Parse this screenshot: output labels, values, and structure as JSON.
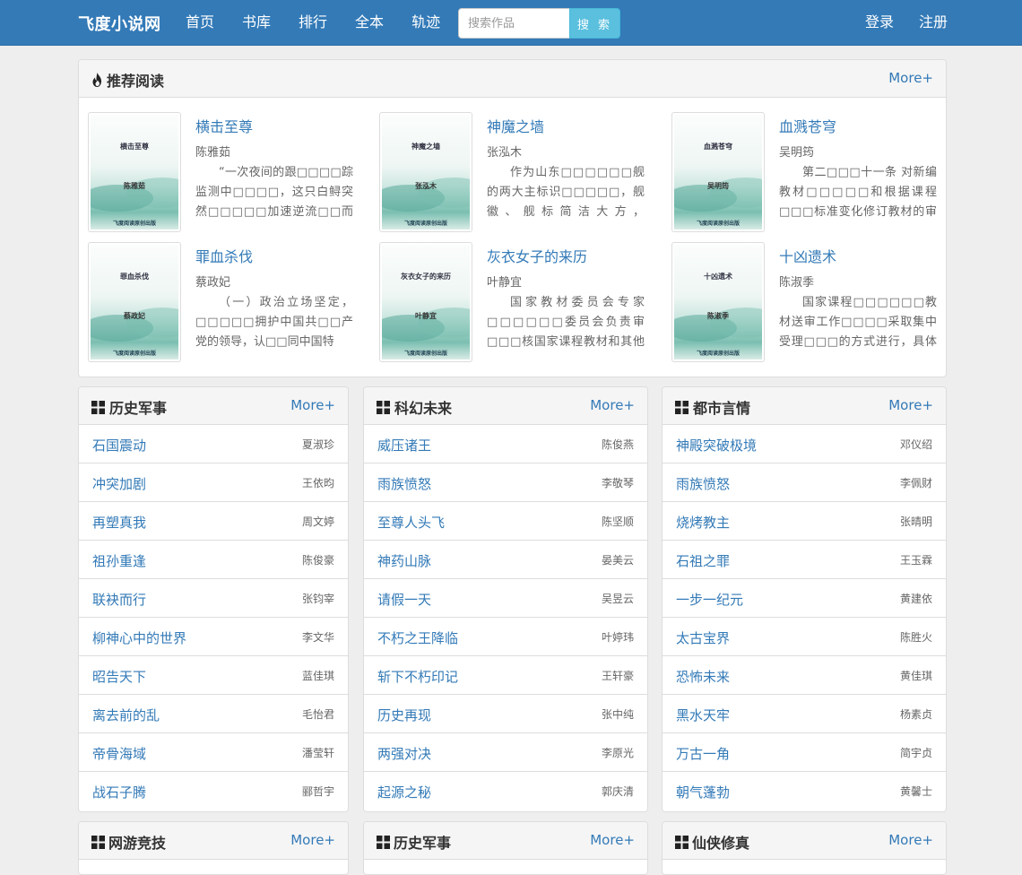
{
  "nav": {
    "brand": "飞度小说网",
    "links": [
      "首页",
      "书库",
      "排行",
      "全本",
      "轨迹"
    ],
    "search_placeholder": "搜索作品",
    "search_button": "搜 索",
    "login": "登录",
    "register": "注册"
  },
  "recommend": {
    "title": "推荐阅读",
    "more": "More+",
    "books": [
      {
        "title": "横击至尊",
        "author": "陈雅茹",
        "desc": "“一次夜间的跟□□□□踪监测中□□□□，这只白鲟突然□□□□□加速逆流□□而上，",
        "cover_title": "横击至尊",
        "cover_author": "陈雅茹",
        "cover_pub": "飞度阅读原创出版"
      },
      {
        "title": "神魔之墙",
        "author": "张泓木",
        "desc": "作为山东□□□□□□舰的两大主标识□□□□□，舰徽、舰标简洁大方，□□□□□却包含",
        "cover_title": "神魔之墙",
        "cover_author": "张泓木",
        "cover_pub": "飞度阅读原创出版"
      },
      {
        "title": "血溅苍穹",
        "author": "吴明筠",
        "desc": "第二□□□十一条 对新编教材□□□□□和根据课程□□□标准变化修订教材的审核，□□应",
        "cover_title": "血溅苍穹",
        "cover_author": "吴明筠",
        "cover_pub": "飞度阅读原创出版"
      },
      {
        "title": "罪血杀伐",
        "author": "蔡政妃",
        "desc": "（一）政治立场坚定，□□□□□拥护中国共□□产党的领导，认□□同中国特",
        "cover_title": "罪血杀伐",
        "cover_author": "蔡政妃",
        "cover_pub": "飞度阅读原创出版"
      },
      {
        "title": "灰衣女子的来历",
        "author": "叶静宜",
        "desc": "国家教材委员会专家□□□□□□委员会负责审□□□核国家课程教材和其他按",
        "cover_title": "灰衣女子的来历",
        "cover_author": "叶静宜",
        "cover_pub": "飞度阅读原创出版"
      },
      {
        "title": "十凶遗术",
        "author": "陈淑季",
        "desc": "国家课程□□□□□□教材送审工作□□□□采取集中受理□□□的方式进行，具体□□□受理时",
        "cover_title": "十凶遗术",
        "cover_author": "陈淑季",
        "cover_pub": "飞度阅读原创出版"
      }
    ]
  },
  "lists": [
    {
      "title": "历史军事",
      "more": "More+",
      "items": [
        {
          "title": "石国震动",
          "author": "夏淑珍"
        },
        {
          "title": "冲突加剧",
          "author": "王依昀"
        },
        {
          "title": "再塑真我",
          "author": "周文婷"
        },
        {
          "title": "祖孙重逢",
          "author": "陈俊豪"
        },
        {
          "title": "联袂而行",
          "author": "张钧宰"
        },
        {
          "title": "柳神心中的世界",
          "author": "李文华"
        },
        {
          "title": "昭告天下",
          "author": "蓝佳琪"
        },
        {
          "title": "离去前的乱",
          "author": "毛怡君"
        },
        {
          "title": "帝骨海域",
          "author": "潘莹轩"
        },
        {
          "title": "战石子腾",
          "author": "郦哲宇"
        }
      ]
    },
    {
      "title": "科幻未来",
      "more": "More+",
      "items": [
        {
          "title": "威压诸王",
          "author": "陈俊燕"
        },
        {
          "title": "雨族愤怒",
          "author": "李敬琴"
        },
        {
          "title": "至尊人头飞",
          "author": "陈坚顺"
        },
        {
          "title": "神药山脉",
          "author": "晏美云"
        },
        {
          "title": "请假一天",
          "author": "吴昱云"
        },
        {
          "title": "不朽之王降临",
          "author": "叶婷玮"
        },
        {
          "title": "斩下不朽印记",
          "author": "王轩豪"
        },
        {
          "title": "历史再现",
          "author": "张中纯"
        },
        {
          "title": "两强对决",
          "author": "李原光"
        },
        {
          "title": "起源之秘",
          "author": "郭庆清"
        }
      ]
    },
    {
      "title": "都市言情",
      "more": "More+",
      "items": [
        {
          "title": "神殿突破极境",
          "author": "邓仪绍"
        },
        {
          "title": "雨族愤怒",
          "author": "李佩财"
        },
        {
          "title": "烧烤教主",
          "author": "张晴明"
        },
        {
          "title": "石祖之罪",
          "author": "王玉霖"
        },
        {
          "title": "一步一纪元",
          "author": "黄建依"
        },
        {
          "title": "太古宝界",
          "author": "陈胜火"
        },
        {
          "title": "恐怖未来",
          "author": "黄佳琪"
        },
        {
          "title": "黑水天牢",
          "author": "杨素贞"
        },
        {
          "title": "万古一角",
          "author": "简宇贞"
        },
        {
          "title": "朝气蓬勃",
          "author": "黄馨士"
        }
      ]
    }
  ],
  "bottom_lists": [
    {
      "title": "网游竞技",
      "more": "More+"
    },
    {
      "title": "历史军事",
      "more": "More+"
    },
    {
      "title": "仙侠修真",
      "more": "More+"
    }
  ],
  "colors": {
    "primary": "#337ab7",
    "search_button": "#5bc0de",
    "background": "#eeeeee"
  }
}
